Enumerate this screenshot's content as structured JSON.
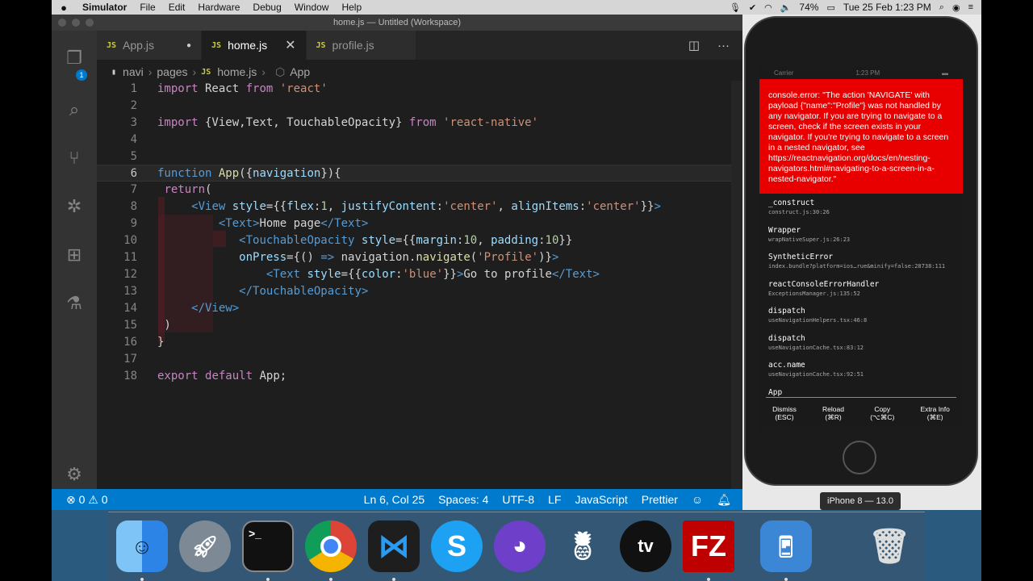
{
  "menubar": {
    "apple": "",
    "items": [
      "Simulator",
      "File",
      "Edit",
      "Hardware",
      "Debug",
      "Window",
      "Help"
    ],
    "battery": "74%",
    "datetime": "Tue 25 Feb  1:23 PM"
  },
  "window": {
    "title": "home.js — Untitled (Workspace)"
  },
  "activity": {
    "badge": "1"
  },
  "tabs": [
    {
      "label": "App.js",
      "marker": "●"
    },
    {
      "label": "home.js",
      "close": "✕"
    },
    {
      "label": "profile.js"
    }
  ],
  "js_badge": "JS",
  "breadcrumb": {
    "parts": [
      "navi",
      "pages",
      "home.js",
      "App"
    ]
  },
  "code_lines": [
    "1",
    "2",
    "3",
    "4",
    "5",
    "6",
    "7",
    "8",
    "9",
    "10",
    "11",
    "12",
    "13",
    "14",
    "15",
    "16",
    "17",
    "18"
  ],
  "status": {
    "problems": "⊗ 0 ⚠ 0",
    "position": "Ln 6, Col 25",
    "spaces": "Spaces: 4",
    "encoding": "UTF-8",
    "eol": "LF",
    "language": "JavaScript",
    "formatter": "Prettier"
  },
  "simulator": {
    "carrier": "Carrier",
    "time": "1:23 PM",
    "error": "console.error: \"The action 'NAVIGATE' with payload {\"name\":\"Profile\"} was not handled by any navigator. If you are trying to navigate to a screen, check if the screen exists in your navigator. If you're trying to navigate to a screen in a nested navigator, see https://reactnavigation.org/docs/en/nesting-navigators.html#navigating-to-a-screen-in-a-nested-navigator.\"",
    "stack": [
      {
        "name": "_construct",
        "loc": "construct.js:30:26"
      },
      {
        "name": "Wrapper",
        "loc": "wrapNativeSuper.js:26:23"
      },
      {
        "name": "SyntheticError",
        "loc": "index.bundle?platform=ios…rue&minify=false:28738:111"
      },
      {
        "name": "reactConsoleErrorHandler",
        "loc": "ExceptionsManager.js:135:52"
      },
      {
        "name": "dispatch",
        "loc": "useNavigationHelpers.tsx:46:8"
      },
      {
        "name": "dispatch",
        "loc": "useNavigationCache.tsx:83:12"
      },
      {
        "name": "acc.name",
        "loc": "useNavigationCache.tsx:92:51"
      },
      {
        "name": "App",
        "loc": ""
      }
    ],
    "actions": [
      {
        "label": "Dismiss",
        "key": "(ESC)"
      },
      {
        "label": "Reload",
        "key": "(⌘R)"
      },
      {
        "label": "Copy",
        "key": "(⌥⌘C)"
      },
      {
        "label": "Extra Info",
        "key": "(⌘E)"
      }
    ],
    "device": "iPhone 8 — 13.0"
  },
  "dock": {
    "terminal": ">_",
    "appletv": "tv",
    "filezilla": "FZ"
  }
}
